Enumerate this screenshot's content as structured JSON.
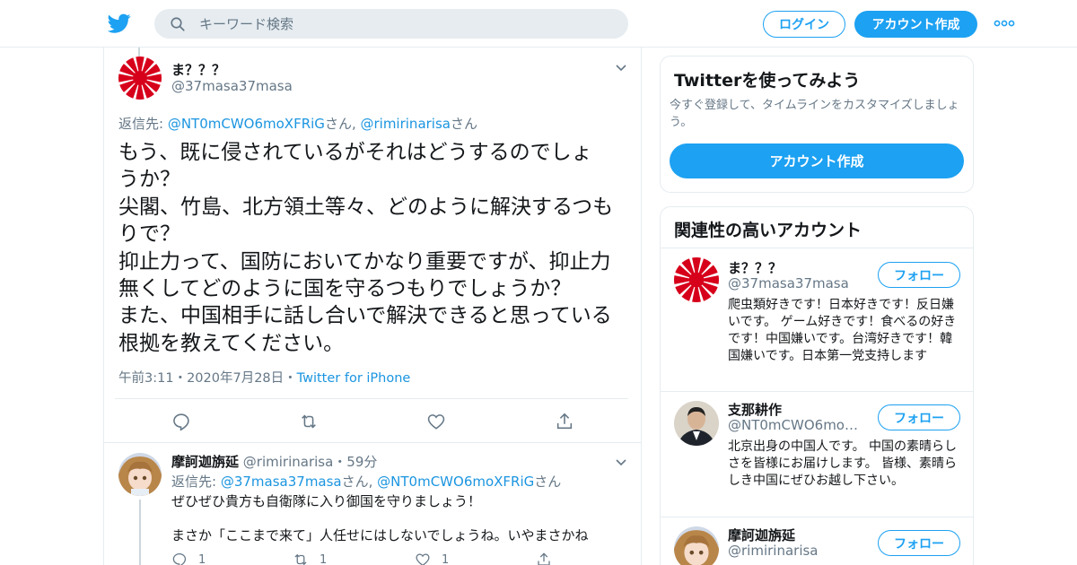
{
  "header": {
    "search_placeholder": "キーワード検索",
    "login_label": "ログイン",
    "signup_label": "アカウント作成"
  },
  "tweet": {
    "name": "ま？？？",
    "handle": "@37masa37masa",
    "reply_prefix": "返信先: ",
    "reply_user1": "@NT0mCWO6moXFRiG",
    "reply_san1": "さん, ",
    "reply_user2": "@rimirinarisa",
    "reply_san2": "さん",
    "text": "もう、既に侵されているがそれはどうするのでしょ\nうか？\n尖閣、竹島、北方領土等々、どのように解決するつも\nりで？\n抑止力って、国防においてかなり重要ですが、抑止力\n無くしてどのように国を守るつもりでしょうか？\nまた、中国相手に話し合いで解決できると思っている\n根拠を教えてください。",
    "time": "午前3:11",
    "dot": "・",
    "date": "2020年7月28日",
    "source": "Twitter for iPhone"
  },
  "reply": {
    "name": "摩訶迦旃延",
    "handle": "@rimirinarisa",
    "age": "・59分",
    "reply_prefix": "返信先: ",
    "reply_user1": "@37masa37masa",
    "reply_san1": "さん, ",
    "reply_user2": "@NT0mCWO6moXFRiG",
    "reply_san2": "さん",
    "text1": "ぜひぜひ貴方も自衛隊に入り御国を守りましょう！",
    "text2": "まさか「ここまで来て」人任せにはしないでしょうね。いやまさかね",
    "reply_count": "1",
    "retweet_count": "1",
    "like_count": "1"
  },
  "sidebar": {
    "try_title": "Twitterを使ってみよう",
    "try_sub": "今すぐ登録して、タイムラインをカスタマイズしましょう。",
    "try_button": "アカウント作成",
    "related_title": "関連性の高いアカウント",
    "follow_label": "フォロー",
    "accounts": [
      {
        "name": "ま？？？",
        "handle": "@37masa37masa",
        "bio": "爬虫類好きです！日本好きです！反日嫌いです。 ゲーム好きです！食べるの好きです！中国嫌いです。台湾好きです！韓国嫌いです。日本第一党支持します"
      },
      {
        "name": "支那耕作",
        "handle": "@NT0mCWO6moXFRiG",
        "bio": "北京出身の中国人です。 中国の素晴らしさを皆様にお届けします。 皆様、素晴らしき中国にぜひお越し下さい。"
      },
      {
        "name": "摩訶迦旃延",
        "handle": "@rimirinarisa",
        "bio": ""
      }
    ]
  },
  "colors": {
    "accent": "#1da1f2",
    "link": "#1b95e0",
    "muted": "#657786",
    "divider": "#e6ecf0"
  },
  "icons": [
    "twitter-bird-icon",
    "search-icon",
    "more-dots-icon",
    "chevron-down-icon",
    "reply-icon",
    "retweet-icon",
    "like-icon",
    "share-icon"
  ]
}
